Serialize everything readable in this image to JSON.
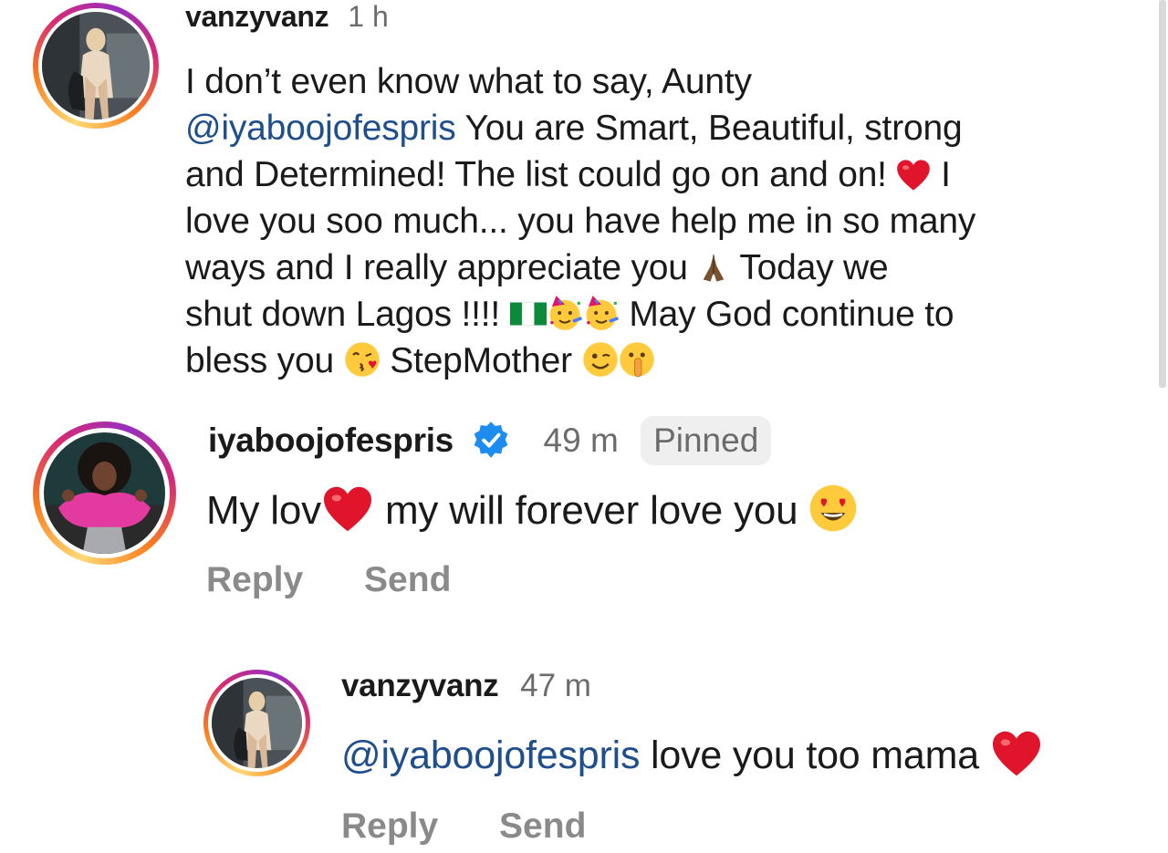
{
  "comments": [
    {
      "username": "vanzyvanz",
      "time": "1 h",
      "text_line1": "I don’t even know what to say, Aunty",
      "mention": "@iyaboojofespris",
      "text_line2": " You are Smart, Beautiful, strong",
      "text_line3": "and Determined! The list could go on and on!",
      "text_line3b": " I",
      "text_line4": "love you soo much... you have help me in so many",
      "text_line5": "ways and I really appreciate you",
      "text_line5b": " Today we",
      "text_line6": "shut down Lagos !!!!",
      "text_line6b": " May God continue to",
      "text_line7": "bless you",
      "text_line7b": " StepMother"
    },
    {
      "username": "iyaboojofespris",
      "time": "49 m",
      "pinned_label": "Pinned",
      "text_a": "My lov",
      "text_b": " my will forever love you",
      "reply_label": "Reply",
      "send_label": "Send"
    },
    {
      "username": "vanzyvanz",
      "time": "47 m",
      "mention": "@iyaboojofespris",
      "text": " love you too mama",
      "reply_label": "Reply",
      "send_label": "Send"
    }
  ],
  "icons": {
    "heart": "heart-icon",
    "pray": "pray-hands-icon",
    "flag": "nigeria-flag-icon",
    "party": "party-face-icon",
    "kiss": "kissing-face-icon",
    "wink": "wink-face-icon",
    "shush": "shushing-face-icon",
    "hearteyes": "heart-eyes-face-icon",
    "verified": "verified-badge-icon"
  },
  "colors": {
    "mention": "#1f4e8c",
    "heart": "#e0142b",
    "verified": "#1d8cf0"
  }
}
